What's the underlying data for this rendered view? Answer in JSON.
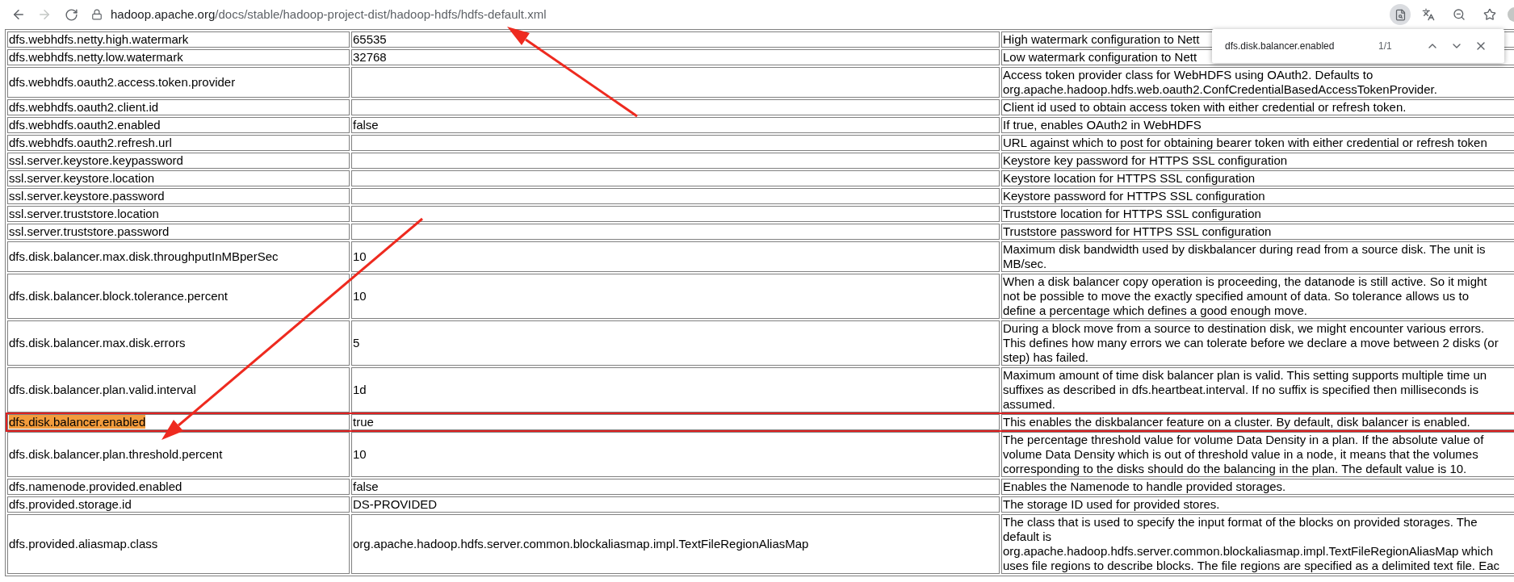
{
  "browser": {
    "forward_disabled": true,
    "url_host": "hadoop.apache.org",
    "url_path": "/docs/stable/hadoop-project-dist/hadoop-hdfs/hdfs-default.xml"
  },
  "find_bar": {
    "query": "dfs.disk.balancer.enabled",
    "count": "1/1"
  },
  "table": {
    "rows": [
      {
        "name": "dfs.webhdfs.netty.high.watermark",
        "value": "65535",
        "description": [
          "High watermark configuration to Nett"
        ],
        "match": false,
        "outlined": false
      },
      {
        "name": "dfs.webhdfs.netty.low.watermark",
        "value": "32768",
        "description": [
          "Low watermark configuration to Nett"
        ],
        "match": false,
        "outlined": false
      },
      {
        "name": "dfs.webhdfs.oauth2.access.token.provider",
        "value": "",
        "description": [
          "Access token provider class for WebHDFS using OAuth2. Defaults to",
          "org.apache.hadoop.hdfs.web.oauth2.ConfCredentialBasedAccessTokenProvider."
        ],
        "match": false,
        "outlined": false
      },
      {
        "name": "dfs.webhdfs.oauth2.client.id",
        "value": "",
        "description": [
          "Client id used to obtain access token with either credential or refresh token."
        ],
        "match": false,
        "outlined": false
      },
      {
        "name": "dfs.webhdfs.oauth2.enabled",
        "value": "false",
        "description": [
          "If true, enables OAuth2 in WebHDFS"
        ],
        "match": false,
        "outlined": false
      },
      {
        "name": "dfs.webhdfs.oauth2.refresh.url",
        "value": "",
        "description": [
          "URL against which to post for obtaining bearer token with either credential or refresh token"
        ],
        "match": false,
        "outlined": false
      },
      {
        "name": "ssl.server.keystore.keypassword",
        "value": "",
        "description": [
          "Keystore key password for HTTPS SSL configuration"
        ],
        "match": false,
        "outlined": false
      },
      {
        "name": "ssl.server.keystore.location",
        "value": "",
        "description": [
          "Keystore location for HTTPS SSL configuration"
        ],
        "match": false,
        "outlined": false
      },
      {
        "name": "ssl.server.keystore.password",
        "value": "",
        "description": [
          "Keystore password for HTTPS SSL configuration"
        ],
        "match": false,
        "outlined": false
      },
      {
        "name": "ssl.server.truststore.location",
        "value": "",
        "description": [
          "Truststore location for HTTPS SSL configuration"
        ],
        "match": false,
        "outlined": false
      },
      {
        "name": "ssl.server.truststore.password",
        "value": "",
        "description": [
          "Truststore password for HTTPS SSL configuration"
        ],
        "match": false,
        "outlined": false
      },
      {
        "name": "dfs.disk.balancer.max.disk.throughputInMBperSec",
        "value": "10",
        "description": [
          "Maximum disk bandwidth used by diskbalancer during read from a source disk. The unit is",
          "MB/sec."
        ],
        "match": false,
        "outlined": false
      },
      {
        "name": "dfs.disk.balancer.block.tolerance.percent",
        "value": "10",
        "description": [
          "When a disk balancer copy operation is proceeding, the datanode is still active. So it might",
          "not be possible to move the exactly specified amount of data. So tolerance allows us to",
          "define a percentage which defines a good enough move."
        ],
        "match": false,
        "outlined": false
      },
      {
        "name": "dfs.disk.balancer.max.disk.errors",
        "value": "5",
        "description": [
          "During a block move from a source to destination disk, we might encounter various errors.",
          "This defines how many errors we can tolerate before we declare a move between 2 disks (or",
          "step) has failed."
        ],
        "match": false,
        "outlined": false
      },
      {
        "name": "dfs.disk.balancer.plan.valid.interval",
        "value": "1d",
        "description": [
          "Maximum amount of time disk balancer plan is valid. This setting supports multiple time un",
          "suffixes as described in dfs.heartbeat.interval. If no suffix is specified then milliseconds is",
          "assumed."
        ],
        "match": false,
        "outlined": false
      },
      {
        "name": "dfs.disk.balancer.enabled",
        "value": "true",
        "description": [
          "This enables the diskbalancer feature on a cluster. By default, disk balancer is enabled."
        ],
        "match": true,
        "outlined": true
      },
      {
        "name": "dfs.disk.balancer.plan.threshold.percent",
        "value": "10",
        "description": [
          "The percentage threshold value for volume Data Density in a plan. If the absolute value of",
          "volume Data Density which is out of threshold value in a node, it means that the volumes",
          "corresponding to the disks should do the balancing in the plan. The default value is 10."
        ],
        "match": false,
        "outlined": false
      },
      {
        "name": "dfs.namenode.provided.enabled",
        "value": "false",
        "description": [
          "Enables the Namenode to handle provided storages."
        ],
        "match": false,
        "outlined": false
      },
      {
        "name": "dfs.provided.storage.id",
        "value": "DS-PROVIDED",
        "description": [
          "The storage ID used for provided stores."
        ],
        "match": false,
        "outlined": false
      },
      {
        "name": "dfs.provided.aliasmap.class",
        "value": "org.apache.hadoop.hdfs.server.common.blockaliasmap.impl.TextFileRegionAliasMap",
        "description": [
          "The class that is used to specify the input format of the blocks on provided storages. The",
          "default is",
          "org.apache.hadoop.hdfs.server.common.blockaliasmap.impl.TextFileRegionAliasMap which",
          "uses file regions to describe blocks. The file regions are specified as a delimited text file. Eac"
        ],
        "match": false,
        "outlined": false
      }
    ]
  }
}
